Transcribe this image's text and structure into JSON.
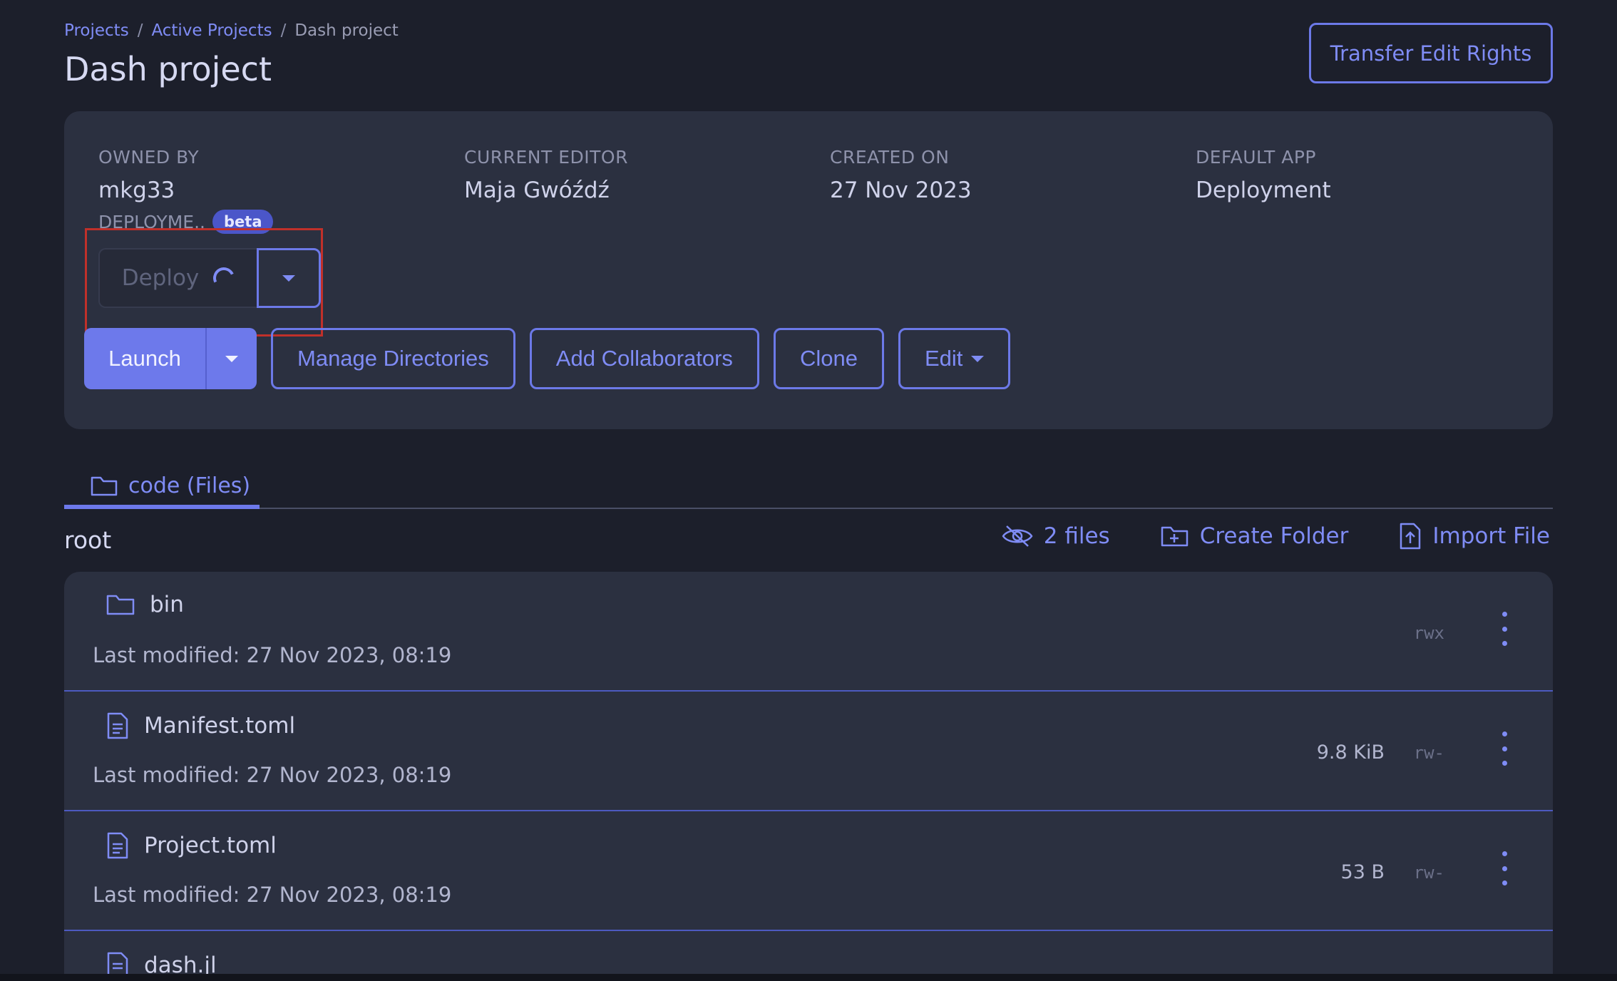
{
  "breadcrumb": {
    "items": [
      "Projects",
      "Active Projects"
    ],
    "current": "Dash project",
    "separator": "/"
  },
  "page_title": "Dash project",
  "transfer_button": "Transfer Edit Rights",
  "meta": {
    "owned_by": {
      "label": "OWNED BY",
      "value": "mkg33"
    },
    "current_editor": {
      "label": "CURRENT EDITOR",
      "value": "Maja Gwóźdź"
    },
    "created_on": {
      "label": "CREATED ON",
      "value": "27 Nov 2023"
    },
    "default_app": {
      "label": "DEFAULT APP",
      "value": "Deployment"
    }
  },
  "deployments": {
    "label": "DEPLOYME...",
    "badge": "beta",
    "deploy_button": "Deploy",
    "deploy_state": "loading"
  },
  "actions": {
    "launch": "Launch",
    "manage_directories": "Manage Directories",
    "add_collaborators": "Add Collaborators",
    "clone": "Clone",
    "edit": "Edit"
  },
  "tabs": [
    {
      "label": "code (Files)",
      "icon": "folder-icon",
      "active": true
    }
  ],
  "files_header": {
    "title": "root",
    "hidden_files": "2 files",
    "create_folder": "Create Folder",
    "import_file": "Import File"
  },
  "files": [
    {
      "name": "bin",
      "type": "folder",
      "icon": "folder-icon",
      "modified": "Last modified: 27 Nov 2023, 08:19",
      "size": "",
      "perms": "rwx"
    },
    {
      "name": "Manifest.toml",
      "type": "file",
      "icon": "file-icon",
      "modified": "Last modified: 27 Nov 2023, 08:19",
      "size": "9.8 KiB",
      "perms": "rw-"
    },
    {
      "name": "Project.toml",
      "type": "file",
      "icon": "file-icon",
      "modified": "Last modified: 27 Nov 2023, 08:19",
      "size": "53 B",
      "perms": "rw-"
    },
    {
      "name": "dash.jl",
      "type": "file",
      "icon": "file-icon",
      "modified": "",
      "size": "",
      "perms": ""
    }
  ],
  "colors": {
    "background": "#1c1f2b",
    "card": "#2b3040",
    "accent": "#6d79eb",
    "highlight": "#c0302a"
  }
}
